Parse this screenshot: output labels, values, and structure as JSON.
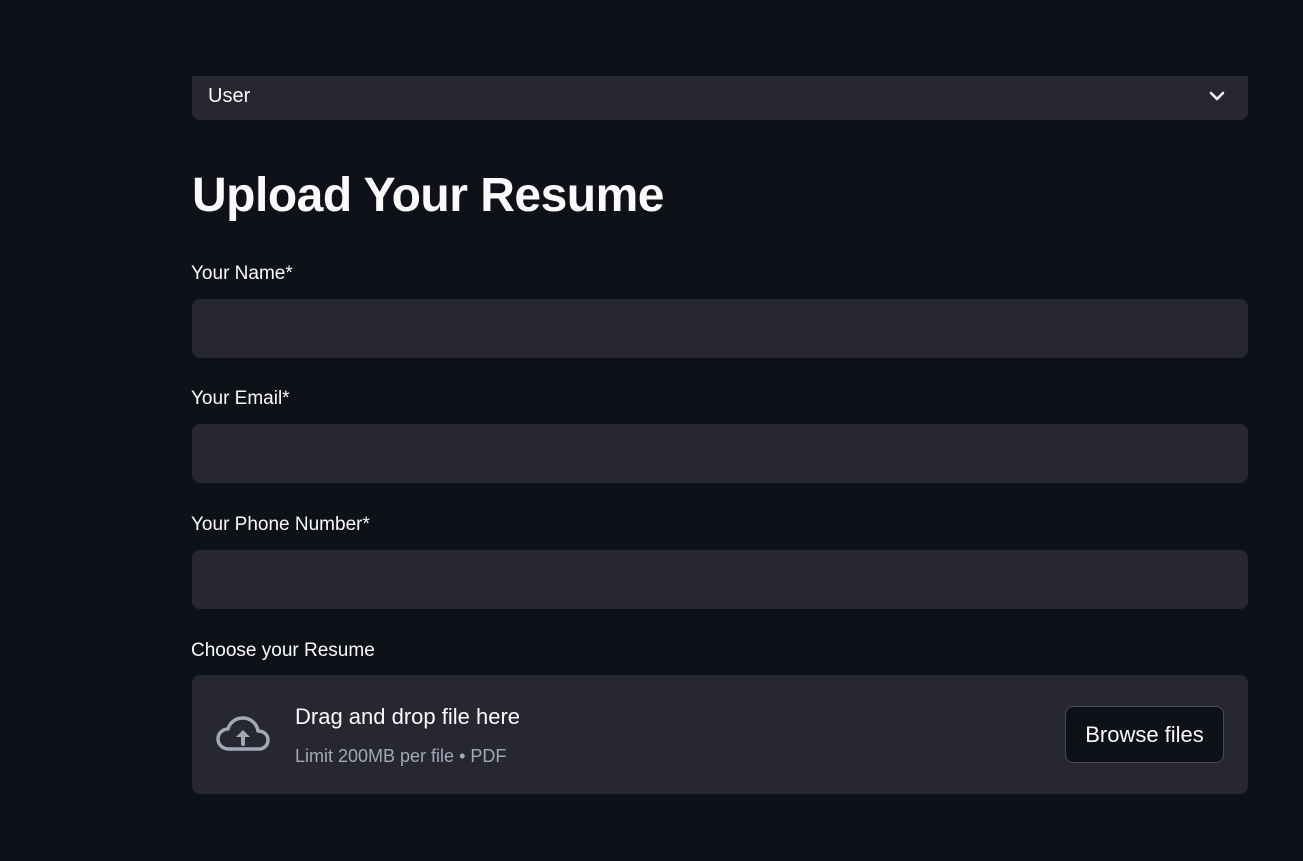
{
  "role_select": {
    "value": "User",
    "icon": "chevron-down-icon"
  },
  "page": {
    "title": "Upload Your Resume"
  },
  "form": {
    "name": {
      "label": "Your Name*",
      "value": ""
    },
    "email": {
      "label": "Your Email*",
      "value": ""
    },
    "phone": {
      "label": "Your Phone Number*",
      "value": ""
    }
  },
  "uploader": {
    "label": "Choose your Resume",
    "drop_text": "Drag and drop file here",
    "limit_text": "Limit 200MB per file • PDF",
    "browse_label": "Browse files",
    "icon": "cloud-upload-icon"
  },
  "colors": {
    "background": "#0e1117",
    "surface": "#262730",
    "text": "#fafafa",
    "muted_text": "#a3a8b8"
  }
}
